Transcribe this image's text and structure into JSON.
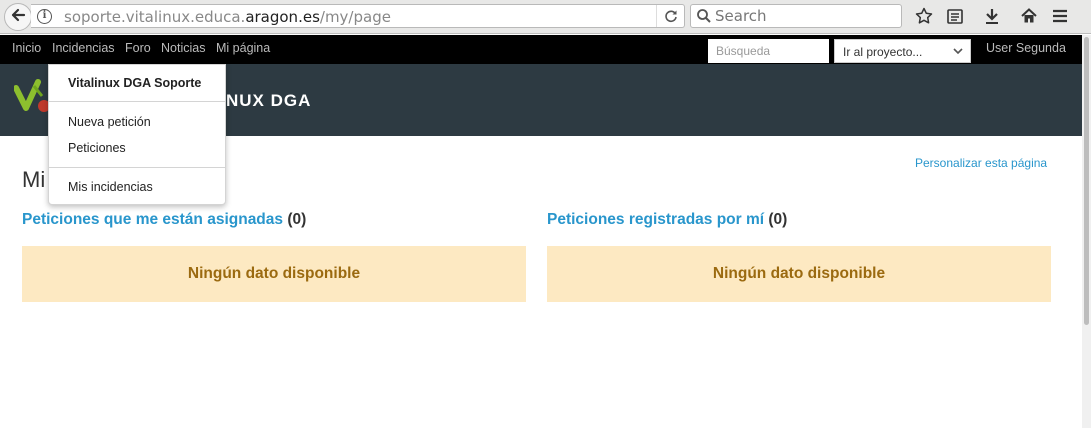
{
  "browser": {
    "url_prefix": "soporte.vitalinux.educa.",
    "url_host": "aragon.es",
    "url_path": "/my/page",
    "search_placeholder": "Search"
  },
  "top_menu": {
    "items": [
      "Inicio",
      "Incidencias",
      "Foro",
      "Noticias",
      "Mi página"
    ],
    "search_placeholder": "Búsqueda",
    "project_select": "Ir al proyecto...",
    "user": "User Segunda"
  },
  "header": {
    "title": "NUX DGA"
  },
  "dropdown": {
    "heading": "Vitalinux DGA Soporte",
    "items": [
      "Nueva petición",
      "Peticiones",
      "Mis incidencias"
    ]
  },
  "page": {
    "title": "Mi",
    "personalize_link": "Personalizar esta página",
    "boxes": [
      {
        "title": "Peticiones que me están asignadas",
        "count": "(0)",
        "empty": "Ningún dato disponible"
      },
      {
        "title": "Peticiones registradas por mí",
        "count": "(0)",
        "empty": "Ningún dato disponible"
      }
    ]
  },
  "colors": {
    "link": "#2996cc",
    "header_bg": "#2d3a42",
    "nodata_bg": "#fde9c2",
    "nodata_text": "#9b6a10"
  }
}
